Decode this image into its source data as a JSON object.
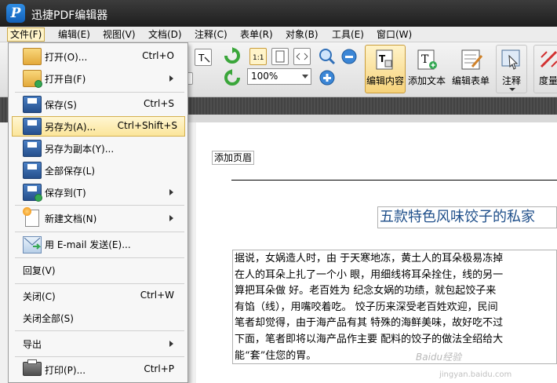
{
  "window": {
    "title": "迅捷PDF编辑器",
    "logo_letter": "P"
  },
  "menubar": {
    "items": [
      "文件(F)",
      "编辑(E)",
      "视图(V)",
      "文档(D)",
      "注释(C)",
      "表单(R)",
      "对象(B)",
      "工具(E)",
      "窗口(W)"
    ]
  },
  "toolbar": {
    "zoom_value": "100%",
    "edit_content": "编辑内容",
    "add_text": "添加文本",
    "edit_form": "编辑表单",
    "comment": "注释",
    "measure": "度量"
  },
  "file_menu": {
    "open": {
      "label": "打开(O)...",
      "shortcut": "Ctrl+O"
    },
    "open_from": {
      "label": "打开自(F)"
    },
    "save": {
      "label": "保存(S)",
      "shortcut": "Ctrl+S"
    },
    "save_as": {
      "label": "另存为(A)...",
      "shortcut": "Ctrl+Shift+S"
    },
    "save_copy": {
      "label": "另存为副本(Y)..."
    },
    "save_all": {
      "label": "全部保存(L)"
    },
    "save_to": {
      "label": "保存到(T)"
    },
    "new_doc": {
      "label": "新建文档(N)"
    },
    "email": {
      "label": "用 E-mail 发送(E)..."
    },
    "revert": {
      "label": "回复(V)"
    },
    "close": {
      "label": "关闭(C)",
      "shortcut": "Ctrl+W"
    },
    "close_all": {
      "label": "关闭全部(S)"
    },
    "export": {
      "label": "导出"
    },
    "print": {
      "label": "打印(P)...",
      "shortcut": "Ctrl+P"
    }
  },
  "document": {
    "header_button": "添加页眉",
    "title": "五款特色风味饺子的私家",
    "body_lines": [
      "据说，女娲造人时，由 于天寒地冻，黄土人的耳朵极易冻掉",
      "在人的耳朵上扎了一个小 眼，用细线将耳朵拴住，线的另一",
      "算把耳朵做 好。老百姓为 纪念女娲的功绩，就包起饺子来",
      "有馅（线），用嘴咬着吃。 饺子历来深受老百姓欢迎，民间",
      "笔者却觉得，由于海产品有其 特殊的海鲜美味，故好吃不过",
      "下面，笔者即将以海产品作主要 配料的饺子的做法全绍给大",
      "能“套”住您的胃。"
    ]
  },
  "watermark": {
    "text": "Baidu经验",
    "sub": "jingyan.baidu.com"
  }
}
